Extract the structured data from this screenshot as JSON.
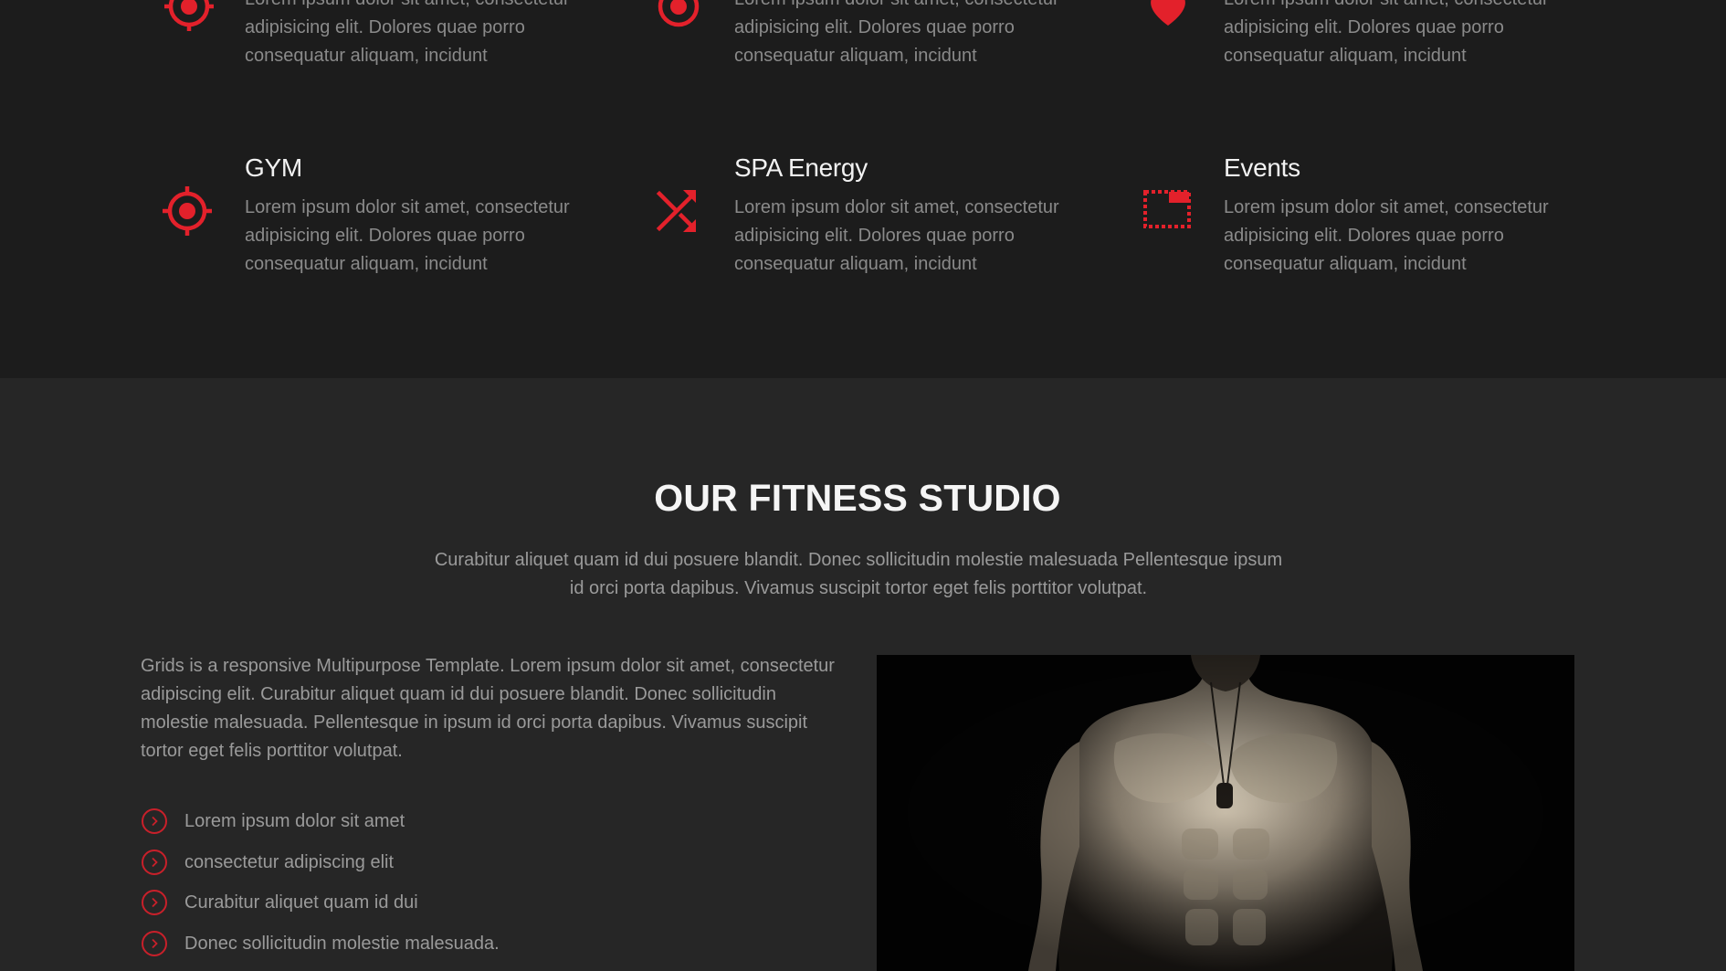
{
  "services": {
    "accent": "#e3212b",
    "top_row": [
      {
        "icon": "target-icon",
        "text": "Lorem ipsum dolor sit amet, consectetur adipisicing elit. Dolores quae porro consequatur aliquam, incidunt"
      },
      {
        "icon": "target-icon",
        "text": "Lorem ipsum dolor sit amet, consectetur adipisicing elit. Dolores quae porro consequatur aliquam, incidunt"
      },
      {
        "icon": "heart-icon",
        "text": "Lorem ipsum dolor sit amet, consectetur adipisicing elit. Dolores quae porro consequatur aliquam, incidunt"
      }
    ],
    "bottom_row": [
      {
        "icon": "target-icon",
        "title": "GYM",
        "text": "Lorem ipsum dolor sit amet, consectetur adipisicing elit. Dolores quae porro consequatur aliquam, incidunt"
      },
      {
        "icon": "shuffle-icon",
        "title": "SPA Energy",
        "text": "Lorem ipsum dolor sit amet, consectetur adipisicing elit. Dolores quae porro consequatur aliquam, incidunt"
      },
      {
        "icon": "calendar-window-icon",
        "title": "Events",
        "text": "Lorem ipsum dolor sit amet, consectetur adipisicing elit. Dolores quae porro consequatur aliquam, incidunt"
      }
    ]
  },
  "studio": {
    "title": "OUR FITNESS STUDIO",
    "subtitle": "Curabitur aliquet quam id dui posuere blandit. Donec sollicitudin molestie malesuada Pellentesque ipsum id orci porta dapibus. Vivamus suscipit tortor eget felis porttitor volutpat.",
    "body": "Grids is a responsive Multipurpose Template. Lorem ipsum dolor sit amet, consectetur adipiscing elit. Curabitur aliquet quam id dui posuere blandit. Donec sollicitudin molestie malesuada. Pellentesque in ipsum id orci porta dapibus. Vivamus suscipit tortor eget felis porttitor volutpat.",
    "list": [
      "Lorem ipsum dolor sit amet",
      "consectetur adipiscing elit",
      "Curabitur aliquet quam id dui",
      "Donec sollicitudin molestie malesuada."
    ],
    "photo_icon": "muscular-man-photo"
  }
}
